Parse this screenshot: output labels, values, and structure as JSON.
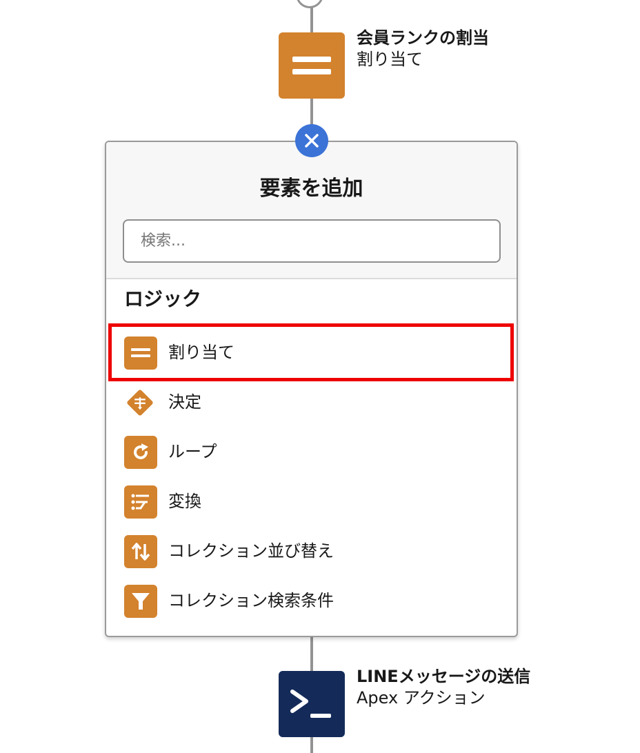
{
  "flow": {
    "node_assign": {
      "title": "会員ランクの割当",
      "subtitle": "割り当て",
      "icon": "equals-icon"
    },
    "node_apex": {
      "title": "LINEメッセージの送信",
      "subtitle": "Apex アクション",
      "icon": "terminal-icon"
    }
  },
  "panel": {
    "title": "要素を追加",
    "search": {
      "placeholder": "検索...",
      "value": ""
    },
    "section_title": "ロジック",
    "items": [
      {
        "label": "割り当て",
        "icon": "equals-icon",
        "highlighted": true
      },
      {
        "label": "決定",
        "icon": "decision-diamond-icon",
        "highlighted": false
      },
      {
        "label": "ループ",
        "icon": "loop-arrow-icon",
        "highlighted": false
      },
      {
        "label": "変換",
        "icon": "transform-icon",
        "highlighted": false
      },
      {
        "label": "コレクション並び替え",
        "icon": "sort-arrows-icon",
        "highlighted": false
      },
      {
        "label": "コレクション検索条件",
        "icon": "filter-funnel-icon",
        "highlighted": false
      }
    ]
  },
  "colors": {
    "logic_orange": "#d3822d",
    "apex_navy": "#142b5a",
    "close_blue": "#3b73d7",
    "highlight_red": "#ee0000",
    "connector_gray": "#939393"
  }
}
